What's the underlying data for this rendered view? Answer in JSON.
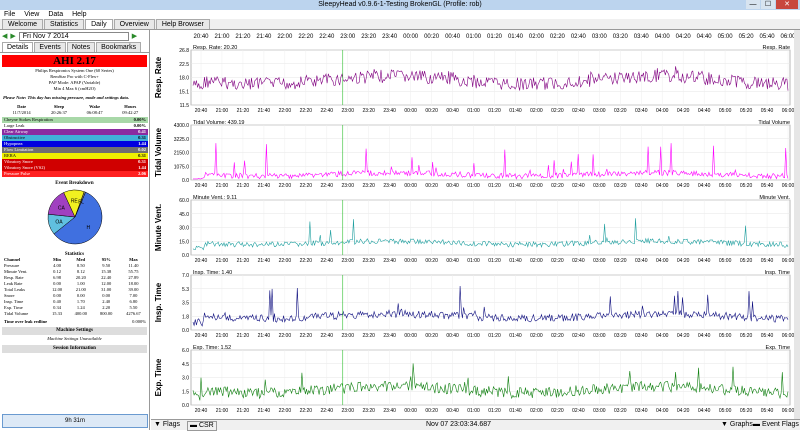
{
  "window": {
    "title": "SleepyHead v0.9.6-1-Testing BrokenGL (Profile: rob)",
    "controls": [
      "—",
      "☐",
      "✕"
    ]
  },
  "menu": [
    "File",
    "View",
    "Data",
    "Help"
  ],
  "tabs": [
    "Welcome",
    "Statistics",
    "Daily",
    "Overview",
    "Help Browser"
  ],
  "left": {
    "date": "Fri Nov 7 2014",
    "subtabs": [
      "Details",
      "Events",
      "Notes",
      "Bookmarks"
    ],
    "ahi": "AHI 2.17",
    "device": [
      "Philips Respironics System One (60 Series)",
      "RemStar Pro with C-Flex+",
      "PAP Mode: APAP (Variable)",
      "Min 4 Max 6 (cmH2O)"
    ],
    "note": "Please Note: This day has missing pressure, mode and settings data.",
    "session": {
      "headers": [
        "Date",
        "Sleep",
        "Wake",
        "Hours"
      ],
      "values": [
        "11/7/2014",
        "20:26:37",
        "06:08:47",
        "09:42:27"
      ]
    },
    "events": [
      {
        "label": "Cheyne Stokes Respiration",
        "value": "0.00%",
        "bg": "#a8d8a8",
        "color": "#000"
      },
      {
        "label": "Large Leak",
        "value": "0.00%",
        "bg": "#ffffff",
        "color": "#000"
      },
      {
        "label": "Clear Airway",
        "value": "0.41",
        "bg": "#8a2ba0",
        "color": "#fff"
      },
      {
        "label": "Obstructive",
        "value": "0.31",
        "bg": "#40b0d8",
        "color": "#000"
      },
      {
        "label": "Hypopnea",
        "value": "1.44",
        "bg": "#0000e0",
        "color": "#fff"
      },
      {
        "label": "Flow Limitation",
        "value": "0.02",
        "bg": "#707070",
        "color": "#fff"
      },
      {
        "label": "RERA",
        "value": "0.31",
        "bg": "#f0f000",
        "color": "#000"
      },
      {
        "label": "Vibratory Snore",
        "value": "0.31",
        "bg": "#d00000",
        "color": "#fff"
      },
      {
        "label": "Vibratory Snore (VS2)",
        "value": "1.44",
        "bg": "#d00000",
        "color": "#fff"
      },
      {
        "label": "Pressure Pulse",
        "value": "2.06",
        "bg": "#ff2020",
        "color": "#fff"
      }
    ],
    "pie": {
      "title": "Event Breakdown",
      "slices": [
        {
          "label": "H",
          "value": 1.44,
          "color": "#4070e0"
        },
        {
          "label": "OA",
          "value": 0.31,
          "color": "#60c0e0"
        },
        {
          "label": "CA",
          "value": 0.41,
          "color": "#a040c0"
        },
        {
          "label": "RE",
          "value": 0.31,
          "color": "#f0f020"
        },
        {
          "label": "FL",
          "value": 0.02,
          "color": "#888888"
        }
      ]
    },
    "stats": {
      "title": "Statistics",
      "headers": [
        "Channel",
        "Min",
        "Med",
        "95%",
        "Max"
      ],
      "rows": [
        [
          "Pressure",
          "4.00",
          "8.50",
          "9.50",
          "11.40"
        ],
        [
          "Minute Vent.",
          "0.12",
          "8.12",
          "15.38",
          "55.75"
        ],
        [
          "Resp. Rate",
          "6.98",
          "20.20",
          "22.40",
          "27.89"
        ],
        [
          "Leak Rate",
          "0.00",
          "1.00",
          "12.00",
          "18.00"
        ],
        [
          "Total Leaks",
          "12.00",
          "21.00",
          "31.00",
          "39.00"
        ],
        [
          "Snore",
          "0.00",
          "0.00",
          "0.00",
          "7.00"
        ],
        [
          "Insp. Time",
          "0.40",
          "1.70",
          "2.40",
          "6.80"
        ],
        [
          "Exp. Time",
          "0.34",
          "1.24",
          "2.20",
          "5.50"
        ],
        [
          "Tidal Volume",
          "15.33",
          "400.00",
          "800.00",
          "4276.67"
        ]
      ]
    },
    "time_over": {
      "label": "Time over leak redline",
      "value": "0.000%"
    },
    "machine_header": "Machine Settings",
    "machine_sub": "Machine Settings Unavailable",
    "session_header": "Session Information",
    "session_bar": "9h 31m"
  },
  "graphs": {
    "time_ticks": [
      "20:40",
      "21:00",
      "21:20",
      "21:40",
      "22:00",
      "22:20",
      "22:40",
      "23:00",
      "23:20",
      "23:40",
      "00:00",
      "00:20",
      "00:40",
      "01:00",
      "01:20",
      "01:40",
      "02:00",
      "02:20",
      "02:40",
      "03:00",
      "03:20",
      "03:40",
      "04:00",
      "04:20",
      "04:40",
      "05:00",
      "05:20",
      "05:40",
      "06:00"
    ],
    "panels": [
      {
        "name": "Resp. Rate",
        "cursor": "Resp. Rate: 20.20",
        "legend": "Resp. Rate",
        "ticks": [
          "26.8",
          "22.5",
          "18.0",
          "15.1",
          "11.5"
        ],
        "color": "#800080",
        "base": 0.55,
        "noise": 0.12,
        "spikes": 0.08
      },
      {
        "name": "Tidal Volume",
        "cursor": "Tidal Volume: 439.19",
        "legend": "Tidal Volume",
        "ticks": [
          "4300.0",
          "3225.0",
          "2150.0",
          "1075.0",
          "0.0"
        ],
        "color": "#ff00ff",
        "base": 0.9,
        "noise": 0.05,
        "spikes": 0.55
      },
      {
        "name": "Minute Vent.",
        "cursor": "Minute Vent.: 9.11",
        "legend": "Minute Vent.",
        "ticks": [
          "60.0",
          "45.0",
          "30.0",
          "15.0",
          "0.0"
        ],
        "color": "#20a0a0",
        "base": 0.78,
        "noise": 0.05,
        "spikes": 0.45
      },
      {
        "name": "Insp. Time",
        "cursor": "Insp. Time: 1.40",
        "legend": "Insp. Time",
        "ticks": [
          "7.0",
          "5.3",
          "3.5",
          "1.8",
          "0.0"
        ],
        "color": "#101080",
        "base": 0.75,
        "noise": 0.07,
        "spikes": 0.55
      },
      {
        "name": "Exp. Time",
        "cursor": "Exp. Time: 1.52",
        "legend": "Exp. Time",
        "ticks": [
          "6.0",
          "4.5",
          "3.0",
          "1.5",
          "0.0"
        ],
        "color": "#108010",
        "base": 0.72,
        "noise": 0.1,
        "spikes": 0.45
      }
    ]
  },
  "bottom": {
    "flags": "Flags",
    "csr": "CSR",
    "timestamp": "Nov 07 23:03:34.687",
    "graphs": "Graphs",
    "event_flags": "Event Flags"
  }
}
